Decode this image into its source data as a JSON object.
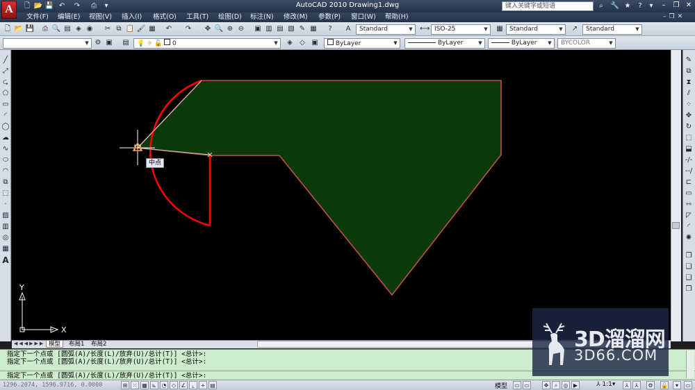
{
  "titlebar": {
    "app_logo": "A",
    "title": "AutoCAD 2010    Drawing1.dwg",
    "search_placeholder": "键入关键字或短语"
  },
  "menu": [
    "文件(F)",
    "编辑(E)",
    "视图(V)",
    "插入(I)",
    "格式(O)",
    "工具(T)",
    "绘图(D)",
    "标注(N)",
    "修改(M)",
    "参数(P)",
    "窗口(W)",
    "帮助(H)"
  ],
  "toolbar1": {
    "text_style": "Standard",
    "dim_style": "ISO-25",
    "table_style": "Standard",
    "multileader_style": "Standard"
  },
  "toolbar2": {
    "workspace": "",
    "layer": "0",
    "color": "ByLayer",
    "linetype": "ByLayer",
    "lineweight": "ByLayer",
    "plotstyle": "BYCOLOR"
  },
  "canvas": {
    "tooltip": "中点",
    "ucs_x": "X",
    "ucs_y": "Y",
    "colors": {
      "fill": "#0a3a0a",
      "edge": "#c0504d",
      "arc": "#ff0000",
      "rubber_band": "#c8c8c8",
      "snap_marker": "#ffa040"
    }
  },
  "tabs": [
    "模型",
    "布局1",
    "布局2"
  ],
  "command": {
    "line1": "指定下一个点或 [圆弧(A)/长度(L)/放弃(U)/总计(T)] <总计>:",
    "line2": "指定下一个点或 [圆弧(A)/长度(L)/放弃(U)/总计(T)] <总计>:",
    "line3": "指定下一个点或 [圆弧(A)/长度(L)/放弃(U)/总计(T)] <总计>:"
  },
  "status": {
    "coords": "1296.2074, 1596.9716, 0.0000",
    "model": "模型",
    "scale": "1:1"
  },
  "watermark": {
    "line1": "3D溜溜网",
    "line2": "3D66.COM"
  }
}
